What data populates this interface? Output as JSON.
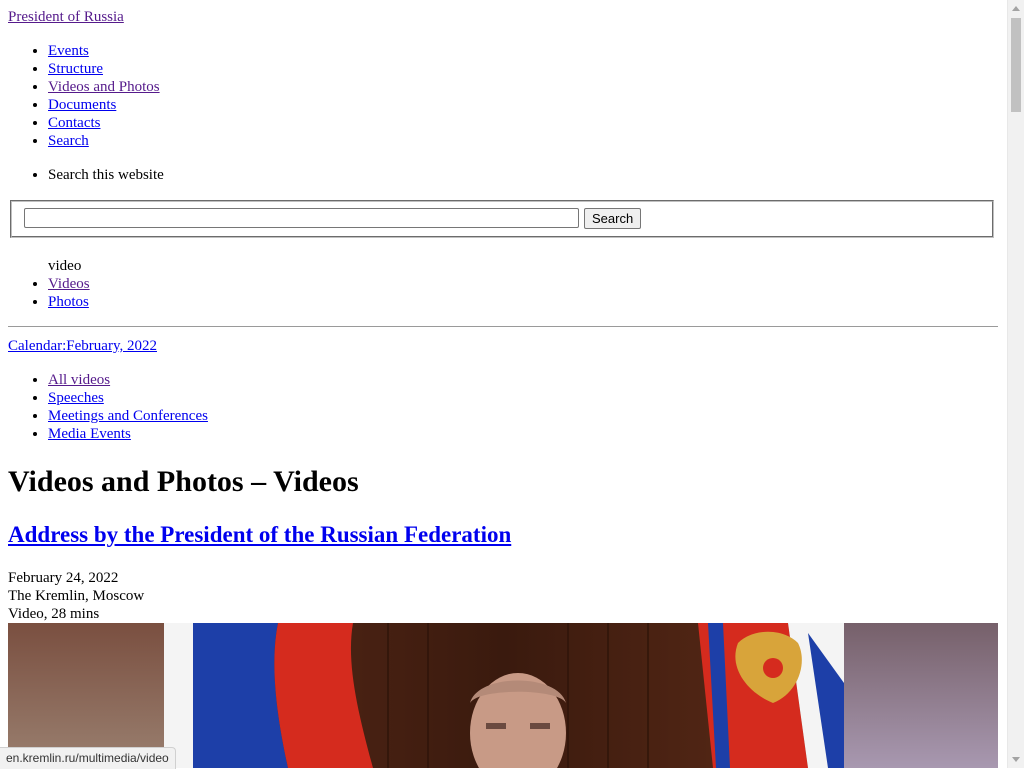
{
  "header": {
    "site_title": "President of Russia"
  },
  "nav_main": [
    {
      "label": "Events"
    },
    {
      "label": "Structure"
    },
    {
      "label": "Videos and Photos"
    },
    {
      "label": "Documents"
    },
    {
      "label": "Contacts"
    },
    {
      "label": "Search"
    }
  ],
  "search": {
    "label": "Search this website",
    "input_value": "",
    "button_label": "Search"
  },
  "section": {
    "label": "video",
    "media_nav": [
      {
        "label": "Videos"
      },
      {
        "label": "Photos"
      }
    ]
  },
  "calendar": {
    "label": "Calendar:February, 2022"
  },
  "video_nav": [
    {
      "label": "All videos"
    },
    {
      "label": "Speeches"
    },
    {
      "label": "Meetings and Conferences"
    },
    {
      "label": "Media Events"
    }
  ],
  "main": {
    "heading": "Videos and Photos – Videos",
    "article": {
      "title": "Address by the President of the Russian Federation",
      "date": "February 24, 2022",
      "place": "The Kremlin, Moscow",
      "type": "Video, 28 mins"
    }
  },
  "status_bar": {
    "url": "en.kremlin.ru/multimedia/video"
  },
  "colors": {
    "link": "#0000ee",
    "visited_link": "#551a8b",
    "flag_white": "#f4f4f4",
    "flag_blue": "#1d3fa8",
    "flag_red": "#d52b1e"
  }
}
